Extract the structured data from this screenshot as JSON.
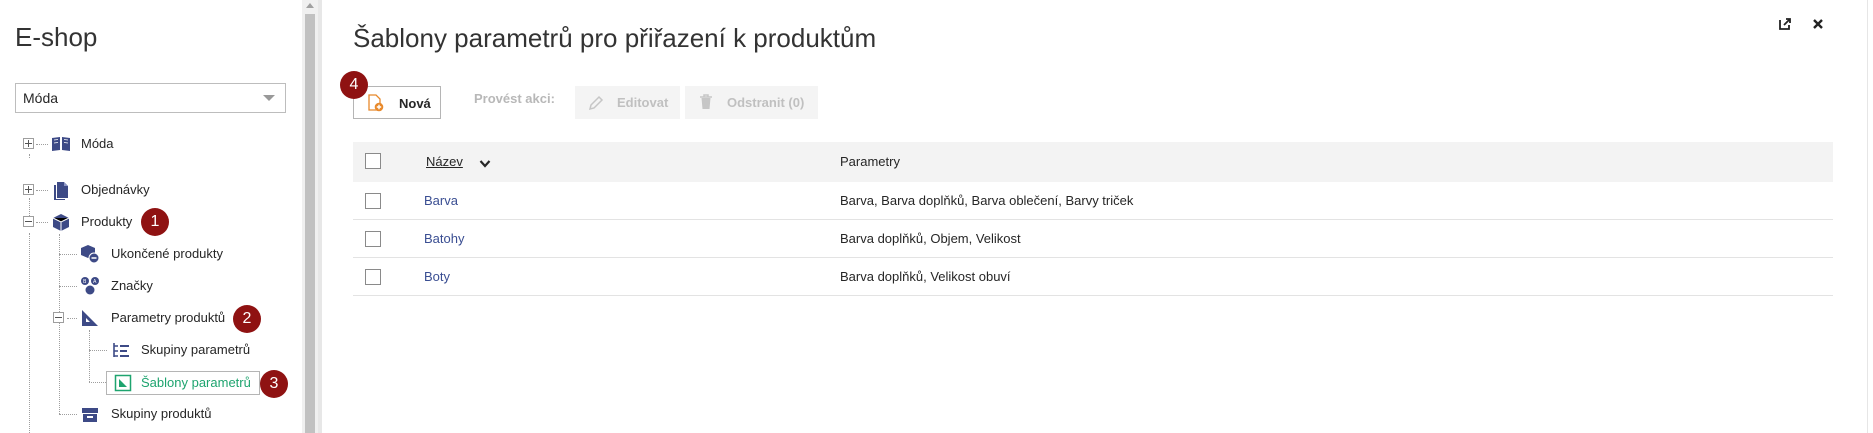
{
  "sidebar": {
    "title": "E-shop",
    "select": {
      "value": "Móda"
    },
    "items": [
      {
        "label": "Móda",
        "icon": "book-icon"
      },
      {
        "label": "Objednávky",
        "icon": "documents-icon"
      },
      {
        "label": "Produkty",
        "icon": "box-icon",
        "badge": "1"
      },
      {
        "label": "Ukončené produkty",
        "icon": "box-discontinued-icon"
      },
      {
        "label": "Značky",
        "icon": "brands-icon"
      },
      {
        "label": "Parametry produktů",
        "icon": "ruler-triangle-icon",
        "badge": "2"
      },
      {
        "label": "Skupiny parametrů",
        "icon": "list-icon"
      },
      {
        "label": "Šablony parametrů",
        "icon": "template-icon",
        "badge": "3"
      },
      {
        "label": "Skupiny produktů",
        "icon": "product-group-icon"
      }
    ]
  },
  "main": {
    "title": "Šablony parametrů pro přiřazení k produktům",
    "toolbar": {
      "new_label": "Nová",
      "new_badge": "4",
      "action_label": "Provést akci:",
      "edit_label": "Editovat",
      "delete_label": "Odstranit (0)"
    },
    "table": {
      "columns": [
        "Název",
        "Parametry"
      ],
      "rows": [
        {
          "name": "Barva",
          "params": "Barva, Barva doplňků, Barva oblečení, Barvy triček"
        },
        {
          "name": "Batohy",
          "params": "Barva doplňků, Objem, Velikost"
        },
        {
          "name": "Boty",
          "params": "Barva doplňků, Velikost obuví"
        }
      ]
    }
  },
  "colors": {
    "accent_green": "#1ea46f",
    "badge_red": "#8f1212",
    "link_blue": "#3a4e92",
    "icon_navy": "#3d4a86"
  }
}
